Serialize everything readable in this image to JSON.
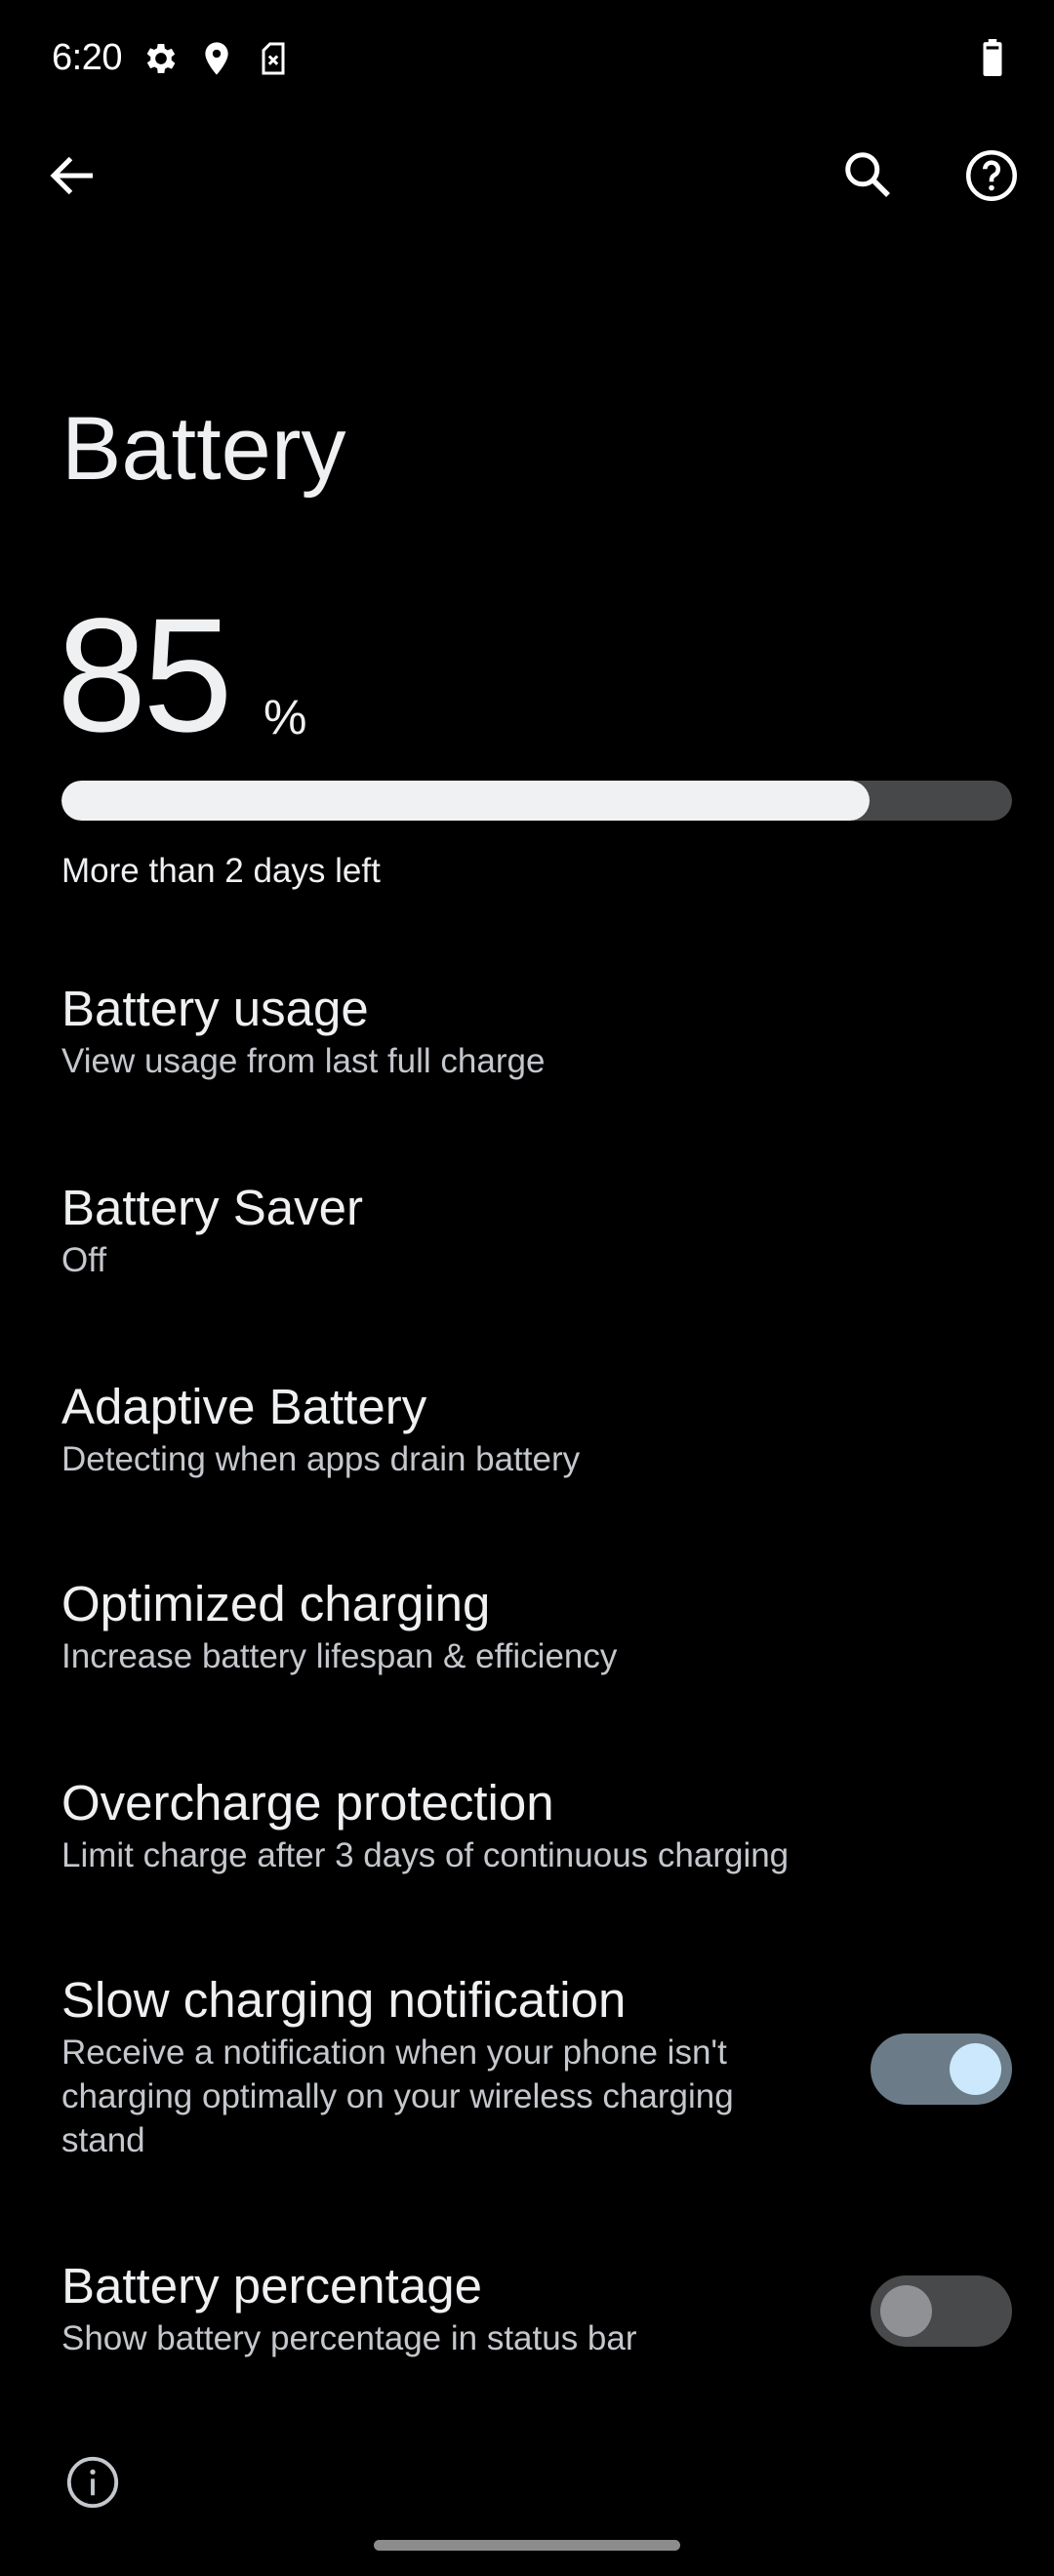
{
  "status_bar": {
    "time": "6:20",
    "icons": [
      "settings-gear-icon",
      "location-pin-icon",
      "no-sim-icon"
    ],
    "battery_icon": "battery-icon"
  },
  "toolbar": {
    "back_icon": "back-arrow-icon",
    "search_icon": "search-icon",
    "help_icon": "help-icon"
  },
  "page": {
    "title": "Battery"
  },
  "battery": {
    "level_value": "85",
    "level_unit": "%",
    "level_percent": 85,
    "estimate": "More than 2 days left"
  },
  "settings": [
    {
      "title": "Battery usage",
      "subtitle": "View usage from last full charge"
    },
    {
      "title": "Battery Saver",
      "subtitle": "Off"
    },
    {
      "title": "Adaptive Battery",
      "subtitle": "Detecting when apps drain battery"
    },
    {
      "title": "Optimized charging",
      "subtitle": "Increase battery lifespan & efficiency"
    },
    {
      "title": "Overcharge protection",
      "subtitle": "Limit charge after 3 days of continuous charging"
    },
    {
      "title": "Slow charging notification",
      "subtitle": "Receive a notification when your phone isn't charging optimally on your wireless charging stand",
      "toggle": true
    },
    {
      "title": "Battery percentage",
      "subtitle": "Show battery percentage in status bar",
      "toggle": false
    }
  ],
  "footer": {
    "info_icon": "info-icon"
  },
  "colors": {
    "background": "#000000",
    "text_primary": "#eff0f2",
    "text_secondary": "#c4c7cc",
    "bar_fill": "#f0f1f3",
    "bar_track": "#47484a",
    "toggle_on_track": "#6b7c88",
    "toggle_on_thumb": "#cce8fd",
    "toggle_off_track": "#47494b",
    "toggle_off_thumb": "#909194"
  }
}
